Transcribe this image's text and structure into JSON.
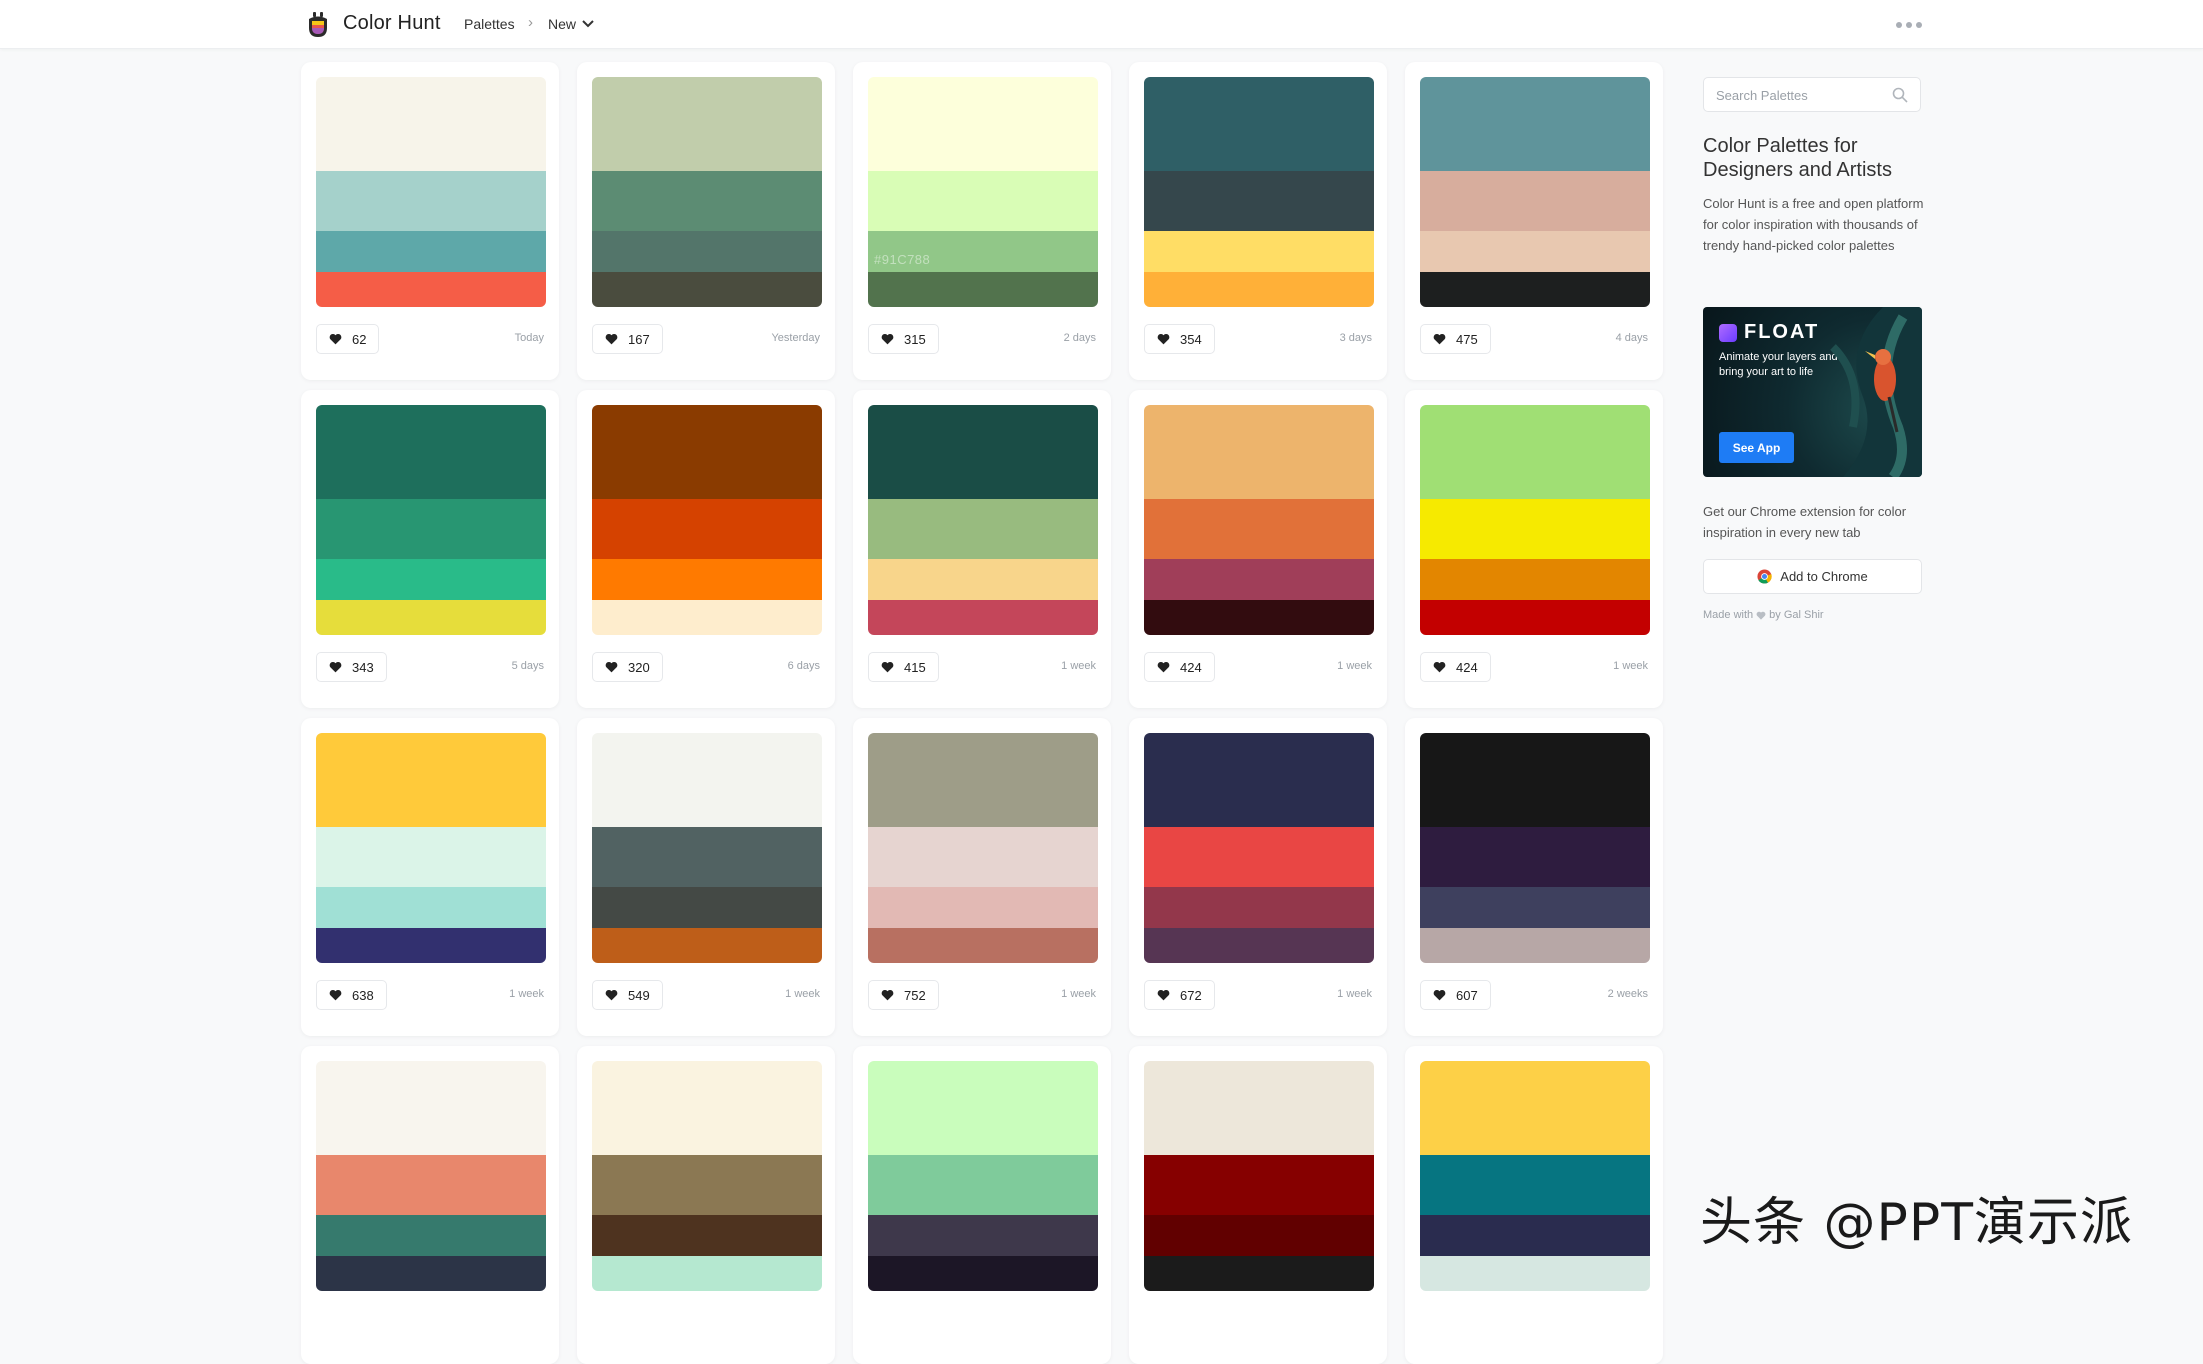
{
  "header": {
    "brand": "Color Hunt",
    "breadcrumb": [
      "Palettes",
      "New"
    ],
    "logo_icon": "color-hunt-logo",
    "more_icon": "ellipsis-icon"
  },
  "palettes": [
    {
      "colors": [
        "#F7F4EA",
        "#A5D1CB",
        "#5EA8A9",
        "#F55D47"
      ],
      "likes": "62",
      "date": "Today"
    },
    {
      "colors": [
        "#C1CDAB",
        "#5C8C73",
        "#53756A",
        "#4A4C3E"
      ],
      "likes": "167",
      "date": "Yesterday"
    },
    {
      "colors": [
        "#FDFFDB",
        "#D9FDB6",
        "#91C788",
        "#52734D"
      ],
      "likes": "315",
      "date": "2 days",
      "hex_label": "#91C788"
    },
    {
      "colors": [
        "#2F5F66",
        "#35474C",
        "#FFDD65",
        "#FFB038"
      ],
      "likes": "354",
      "date": "3 days"
    },
    {
      "colors": [
        "#5F949B",
        "#D7AD9D",
        "#E8C8B0",
        "#1D1F1F"
      ],
      "likes": "475",
      "date": "4 days"
    },
    {
      "colors": [
        "#1E6F5C",
        "#289672",
        "#29BB89",
        "#E6DD3B"
      ],
      "likes": "343",
      "date": "5 days"
    },
    {
      "colors": [
        "#8A3B00",
        "#D54200",
        "#FF7A00",
        "#FEEDCD"
      ],
      "likes": "320",
      "date": "6 days"
    },
    {
      "colors": [
        "#1A4D46",
        "#98BB7F",
        "#F8D58B",
        "#C4465A"
      ],
      "likes": "415",
      "date": "1 week"
    },
    {
      "colors": [
        "#EDB46C",
        "#E17139",
        "#A03E59",
        "#320C0F"
      ],
      "likes": "424",
      "date": "1 week"
    },
    {
      "colors": [
        "#A0DF74",
        "#F6EA00",
        "#E38600",
        "#C30000"
      ],
      "likes": "424",
      "date": "1 week"
    },
    {
      "colors": [
        "#FFCA3A",
        "#DBF4E8",
        "#A0E0D5",
        "#32306F"
      ],
      "likes": "638",
      "date": "1 week"
    },
    {
      "colors": [
        "#F3F4EF",
        "#516262",
        "#444945",
        "#BE5E19"
      ],
      "likes": "549",
      "date": "1 week"
    },
    {
      "colors": [
        "#9E9D88",
        "#E6D4D0",
        "#E2B9B4",
        "#B87061"
      ],
      "likes": "752",
      "date": "1 week"
    },
    {
      "colors": [
        "#2A2D4E",
        "#E94644",
        "#93374B",
        "#563553"
      ],
      "likes": "672",
      "date": "1 week"
    },
    {
      "colors": [
        "#171717",
        "#2E1C3F",
        "#3E405E",
        "#B7A7A6"
      ],
      "likes": "607",
      "date": "2 weeks"
    },
    {
      "colors": [
        "#F8F5EE",
        "#E8876C",
        "#367A6D",
        "#2C3447"
      ],
      "likes": "",
      "date": ""
    },
    {
      "colors": [
        "#FAF3E0",
        "#8B7853",
        "#4E331F",
        "#B5E8D0"
      ],
      "likes": "",
      "date": ""
    },
    {
      "colors": [
        "#C9FDBC",
        "#7FCB9B",
        "#3E384B",
        "#1C1626"
      ],
      "likes": "",
      "date": ""
    },
    {
      "colors": [
        "#EDE7DA",
        "#860000",
        "#610000",
        "#1B1B1B"
      ],
      "likes": "",
      "date": ""
    },
    {
      "colors": [
        "#FDD047",
        "#067581",
        "#2A2C4F",
        "#D6E7E1"
      ],
      "likes": "",
      "date": ""
    }
  ],
  "sidebar": {
    "search_placeholder": "Search Palettes",
    "title": "Color Palettes for Designers and Artists",
    "description": "Color Hunt is a free and open platform for color inspiration with thousands of trendy hand-picked color palettes",
    "ad": {
      "brand": "FLOAT",
      "text": "Animate your layers and bring your art to life",
      "button": "See App"
    },
    "extension_text": "Get our Chrome extension for color inspiration in every new tab",
    "add_chrome": "Add to Chrome",
    "made_with_prefix": "Made with",
    "made_with_suffix": "by Gal Shir"
  },
  "watermark": "头条 @PPT演示派"
}
